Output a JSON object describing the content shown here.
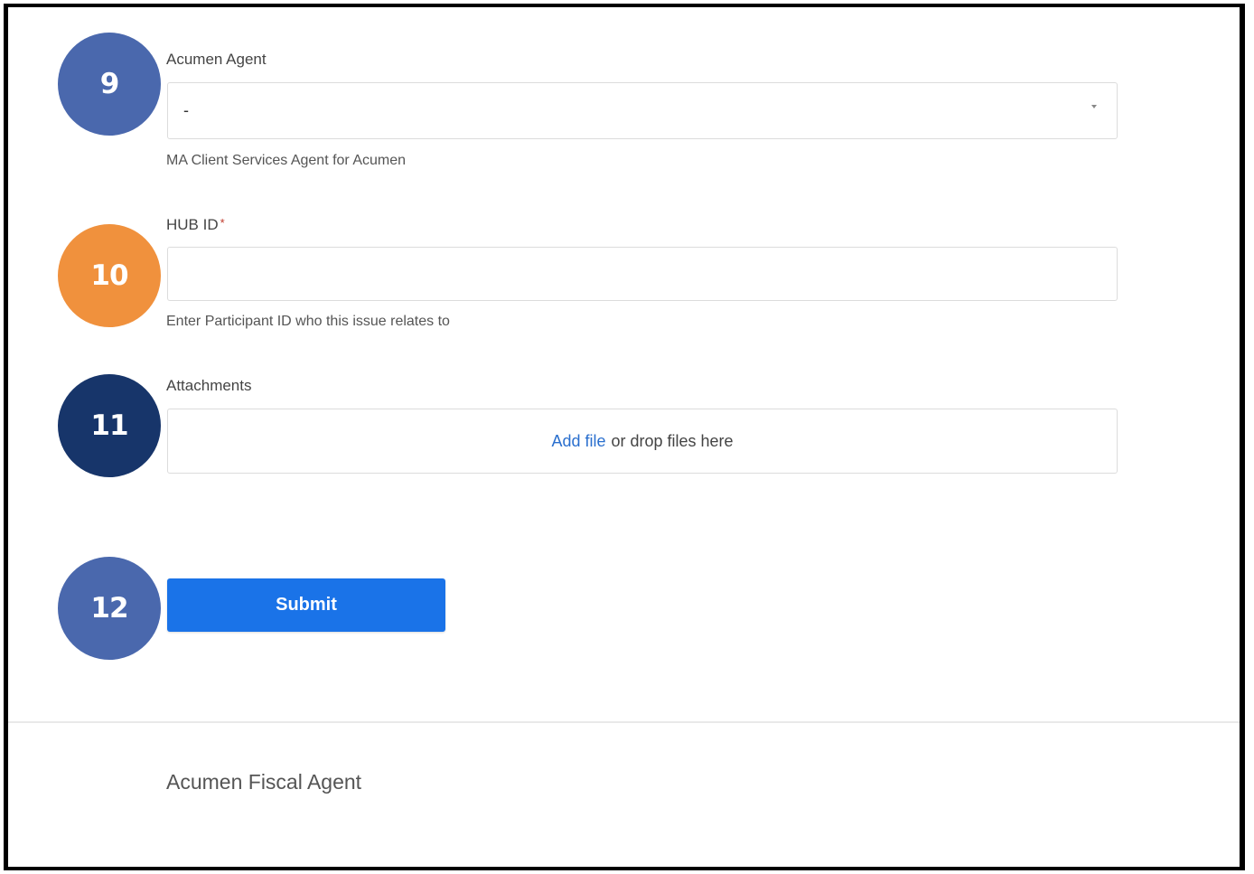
{
  "badges": [
    {
      "number": "9",
      "color": "#4a68ad"
    },
    {
      "number": "10",
      "color": "#f0913d"
    },
    {
      "number": "11",
      "color": "#17356a"
    },
    {
      "number": "12",
      "color": "#4a68ad"
    }
  ],
  "acumen_agent": {
    "label": "Acumen Agent",
    "selected_value": "-",
    "help_text": "MA Client Services Agent for Acumen"
  },
  "hub_id": {
    "label": "HUB ID",
    "required_marker": "*",
    "value": "",
    "placeholder": "",
    "help_text": "Enter Participant ID who this issue relates to"
  },
  "attachments": {
    "label": "Attachments",
    "add_file_link": "Add file",
    "drop_text": "or drop files here"
  },
  "submit": {
    "label": "Submit",
    "color": "#1a73e8"
  },
  "footer": {
    "text": "Acumen Fiscal Agent"
  }
}
